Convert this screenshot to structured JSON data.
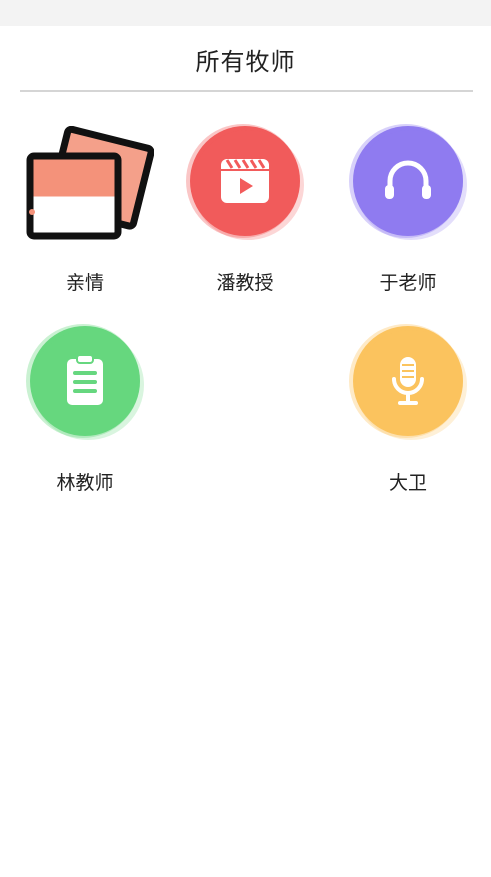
{
  "header": {
    "title": "所有牧师"
  },
  "tiles": [
    {
      "label": "亲情",
      "icon": "photo-stack-icon",
      "color": "#f4927a"
    },
    {
      "label": "潘教授",
      "icon": "video-clapper-icon",
      "color": "#f25b5b"
    },
    {
      "label": "于老师",
      "icon": "headphones-icon",
      "color": "#8f7cf0"
    },
    {
      "label": "林教师",
      "icon": "clipboard-list-icon",
      "color": "#66d77f"
    },
    {
      "label": "大卫",
      "icon": "microphone-icon",
      "color": "#fbc45e"
    }
  ]
}
